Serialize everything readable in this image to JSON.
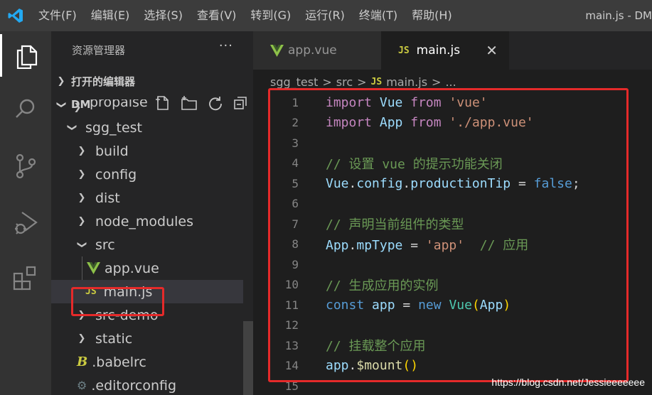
{
  "menu": [
    "文件(F)",
    "编辑(E)",
    "选择(S)",
    "查看(V)",
    "转到(G)",
    "运行(R)",
    "终端(T)",
    "帮助(H)"
  ],
  "window_title": "main.js - DM",
  "sidebar": {
    "title": "资源管理器",
    "more": "···",
    "open_editors": "打开的编辑器",
    "workspace": "DM",
    "tree": [
      {
        "label": "propaise",
        "kind": "folder-clipped"
      },
      {
        "label": "sgg_test",
        "kind": "folder-open"
      },
      {
        "label": "build",
        "kind": "folder"
      },
      {
        "label": "config",
        "kind": "folder"
      },
      {
        "label": "dist",
        "kind": "folder"
      },
      {
        "label": "node_modules",
        "kind": "folder"
      },
      {
        "label": "src",
        "kind": "folder-open"
      },
      {
        "label": "app.vue",
        "kind": "vue"
      },
      {
        "label": "main.js",
        "kind": "js"
      },
      {
        "label": "src-demo",
        "kind": "folder"
      },
      {
        "label": "static",
        "kind": "folder"
      },
      {
        "label": ".babelrc",
        "kind": "babel"
      },
      {
        "label": ".editorconfig",
        "kind": "config"
      }
    ]
  },
  "tabs": [
    {
      "label": "app.vue",
      "icon": "vue-icon"
    },
    {
      "label": "main.js",
      "icon": "js-icon"
    }
  ],
  "breadcrumb": {
    "folder1": "sgg_test",
    "folder2": "src",
    "file": "main.js",
    "sep": ">",
    "ellipsis": "..."
  },
  "code": {
    "line_numbers": [
      "1",
      "2",
      "3",
      "4",
      "5",
      "6",
      "7",
      "8",
      "9",
      "10",
      "11",
      "12",
      "13",
      "14",
      "15"
    ],
    "lines": [
      "import Vue from 'vue'",
      "import App from './app.vue'",
      "",
      "// 设置 vue 的提示功能关闭",
      "Vue.config.productionTip = false;",
      "",
      "// 声明当前组件的类型",
      "App.mpType = 'app'  // 应用",
      "",
      "// 生成应用的实例",
      "const app = new Vue(App)",
      "",
      "// 挂载整个应用",
      "app.$mount()",
      ""
    ]
  },
  "js_badge": "JS",
  "watermark": "https://blog.csdn.net/Jessieeeeeee",
  "colors": {
    "highlight": "#e52a2a",
    "vue_green": "#41b883",
    "js_yellow": "#cbcb41"
  }
}
